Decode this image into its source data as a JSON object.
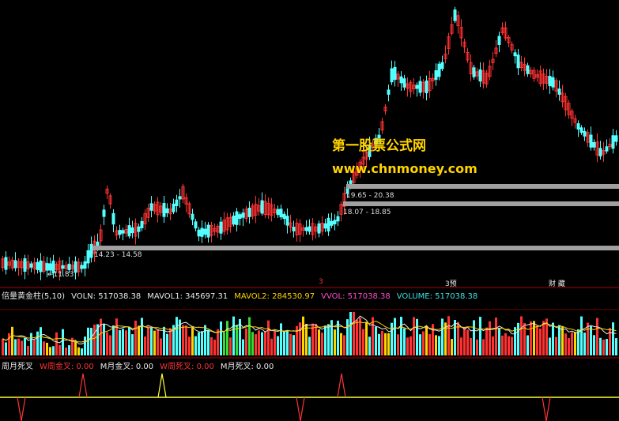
{
  "watermark": {
    "line1": "第一股票公式网",
    "line2": "www.chnmoney.com"
  },
  "price_panel": {
    "price_low_label": "11.83",
    "bands": [
      {
        "label": "19.65 - 20.38"
      },
      {
        "label": "18.07 - 18.85"
      },
      {
        "label": "14.23 - 14.58"
      }
    ],
    "events": [
      "3",
      "3预",
      "财 藏"
    ]
  },
  "volume_panel": {
    "title": "倍量黄金柱(5,10)",
    "items": [
      {
        "text": "VOLN: 517038.38",
        "color": "#e8e8e8"
      },
      {
        "text": "MAVOL1: 345697.31",
        "color": "#e8e8e8"
      },
      {
        "text": "MAVOL2: 284530.97",
        "color": "#ffd400"
      },
      {
        "text": "VVOL: 517038.38",
        "color": "#ff4ec8"
      },
      {
        "text": "VOLUME: 517038.38",
        "color": "#3fe0e0"
      }
    ]
  },
  "indicator_panel": {
    "title": "周月死叉",
    "items": [
      {
        "text": "W周金叉: 0.00",
        "color": "#ff3333"
      },
      {
        "text": "M月金叉: 0.00",
        "color": "#e8e8e8"
      },
      {
        "text": "W周死叉: 0.00",
        "color": "#ff3333"
      },
      {
        "text": "M月死叉: 0.00",
        "color": "#e8e8e8"
      }
    ]
  },
  "colors": {
    "up": "#ff3232",
    "down": "#54ffff",
    "band": "#a0a0a0",
    "gold": "#ffd400",
    "separator": "#b00000"
  }
}
